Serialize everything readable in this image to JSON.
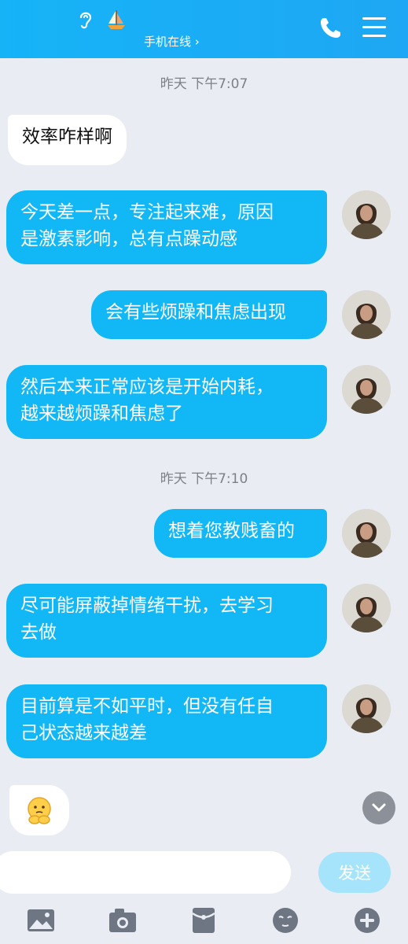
{
  "header": {
    "subtitle": "手机在线 ›",
    "icons": [
      "hearing-icon",
      "sailboat-icon",
      "phone-icon",
      "menu-icon"
    ]
  },
  "messages": [
    {
      "type": "timestamp",
      "text": "昨天 下午7:07"
    },
    {
      "type": "other",
      "lines": [
        "效率咋样啊"
      ]
    },
    {
      "type": "me",
      "lines": [
        "今天差一点，专注起来难，原因",
        "是激素影响，总有点躁动感"
      ]
    },
    {
      "type": "me",
      "lines": [
        "会有些烦躁和焦虑出现"
      ]
    },
    {
      "type": "me",
      "lines": [
        "然后本来正常应该是开始内耗，",
        "越来越烦躁和焦虑了"
      ]
    },
    {
      "type": "timestamp",
      "text": "昨天 下午7:10"
    },
    {
      "type": "me",
      "lines": [
        "想着您教贱畜的"
      ]
    },
    {
      "type": "me",
      "lines": [
        "尽可能屏蔽掉情绪干扰，去学习",
        "去做"
      ]
    },
    {
      "type": "me",
      "lines": [
        "目前算是不如平时，但没有任自",
        "己状态越来越差"
      ]
    },
    {
      "type": "other",
      "emoji": "thinking-emoji"
    }
  ],
  "input": {
    "placeholder": "",
    "send_label": "发送"
  },
  "toolbar": [
    "image-icon",
    "camera-icon",
    "red-packet-icon",
    "emoji-icon",
    "plus-icon"
  ],
  "colors": {
    "header": "#16b3f7",
    "my_bubble": "#12b7f5",
    "send_button": "#a6e4fb",
    "background": "#e9edf3"
  }
}
